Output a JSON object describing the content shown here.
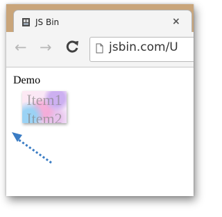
{
  "browser": {
    "tab": {
      "title": "JS Bin",
      "close_glyph": "×",
      "favicon": "jsbin-favicon-icon"
    },
    "nav": {
      "back_glyph": "←",
      "forward_glyph": "→",
      "reload_glyph": "C"
    },
    "address_bar": {
      "url": "jsbin.com/U",
      "page_icon": "page-icon"
    },
    "colors": {
      "tabstrip": "#c9a57a",
      "toolbar": "#f4f4f4",
      "arrow": "#3a7cc4"
    }
  },
  "page": {
    "heading": "Demo",
    "drag_widget": {
      "items": [
        "Item1",
        "Item2"
      ]
    }
  },
  "annotation": {
    "arrow_icon": "dotted-arrow-icon"
  }
}
